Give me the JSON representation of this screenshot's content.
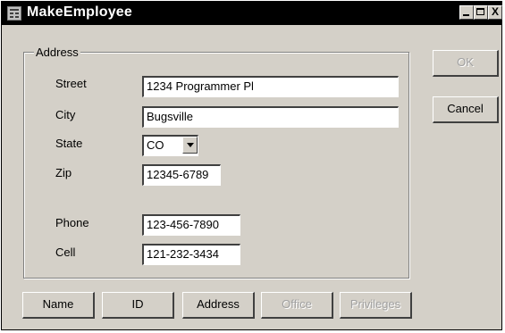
{
  "window": {
    "title": "MakeEmployee",
    "minimize_label": "_",
    "maximize_label": "□",
    "close_label": "X"
  },
  "address_group": {
    "legend": "Address",
    "fields": {
      "street": {
        "label": "Street",
        "value": "1234 Programmer Pl"
      },
      "city": {
        "label": "City",
        "value": "Bugsville"
      },
      "state": {
        "label": "State",
        "value": "CO"
      },
      "zip": {
        "label": "Zip",
        "value": "12345-6789"
      },
      "phone": {
        "label": "Phone",
        "value": "123-456-7890"
      },
      "cell": {
        "label": "Cell",
        "value": "121-232-3434"
      }
    }
  },
  "buttons": {
    "ok": {
      "label": "OK",
      "enabled": false
    },
    "cancel": {
      "label": "Cancel",
      "enabled": true
    }
  },
  "tabs": [
    {
      "label": "Name",
      "enabled": true
    },
    {
      "label": "ID",
      "enabled": true
    },
    {
      "label": "Address",
      "enabled": true
    },
    {
      "label": "Office",
      "enabled": false
    },
    {
      "label": "Privileges",
      "enabled": false
    }
  ],
  "colors": {
    "window_bg": "#d4d0c8",
    "titlebar_bg": "#000000",
    "field_bg": "#ffffff",
    "disabled_text": "#a0a0a0"
  }
}
